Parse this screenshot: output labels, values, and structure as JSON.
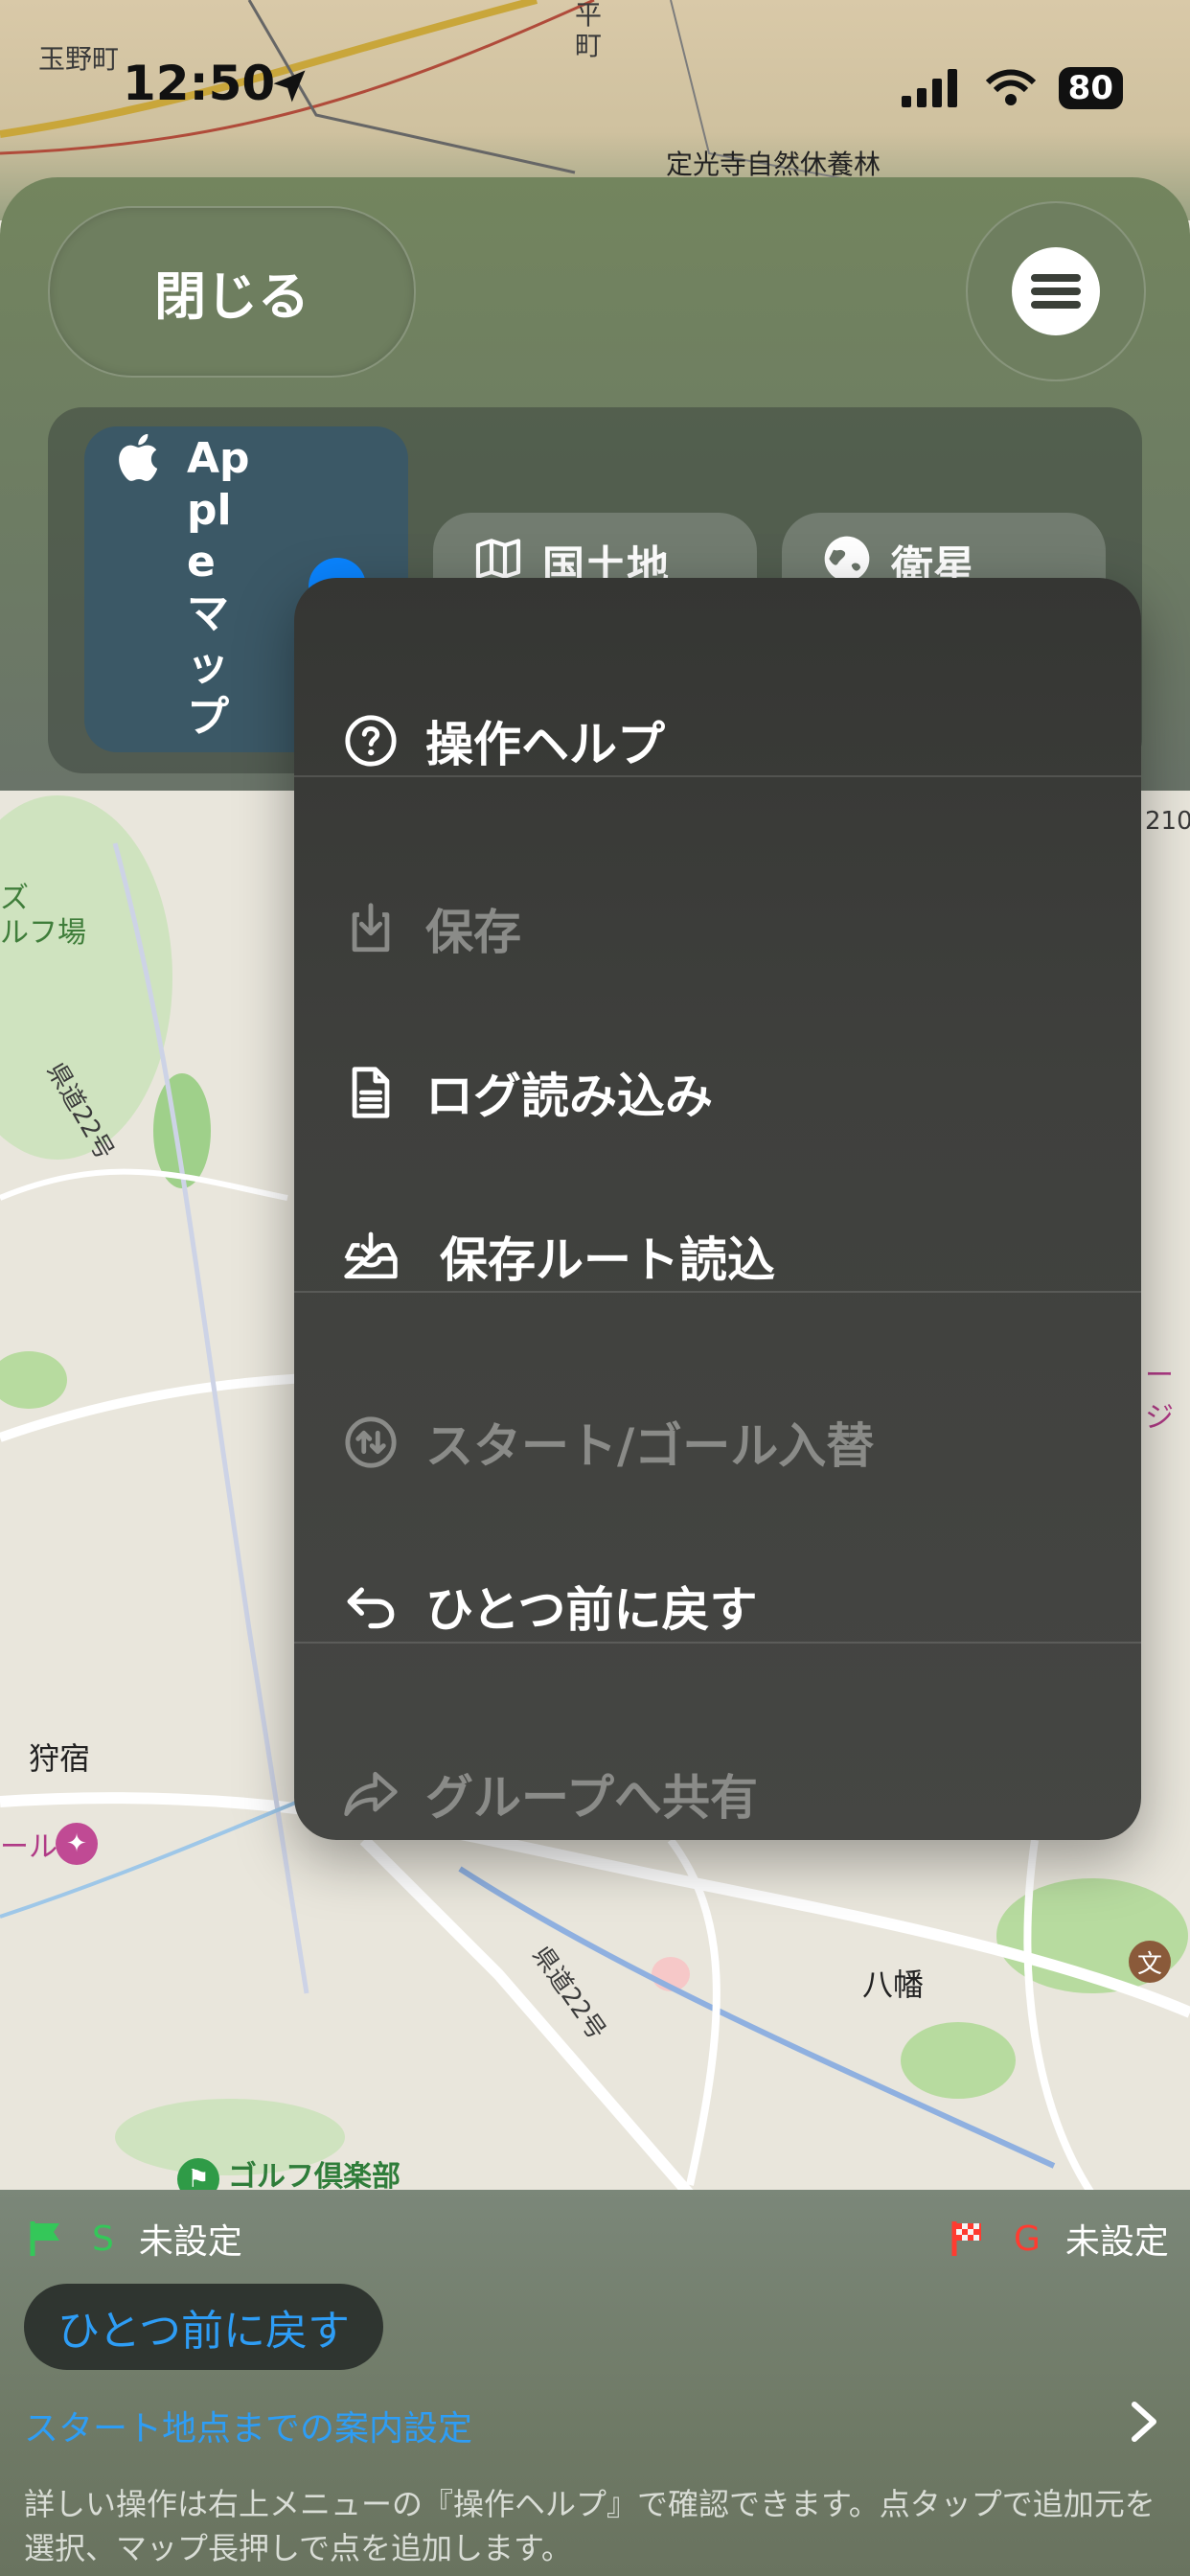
{
  "status_bar": {
    "time": "12:50",
    "battery": "80"
  },
  "map_labels": {
    "top_left": "玉野町",
    "top_mid": "平町",
    "top_right": "定光寺自然休養林",
    "golf": "ズ\nルフ場",
    "road1": "県道22号",
    "kariyado": "狩宿",
    "ball": "ール",
    "road2": "県道22号",
    "yawata": "八幡",
    "golf_club": "ゴルフ倶楽部",
    "route_num": "210",
    "side_text": "ージ"
  },
  "header": {
    "close_label": "閉じる",
    "menu_icon": "list-icon"
  },
  "map_source": {
    "apple_label": "Apple マップ",
    "gsi_label": "国土地",
    "satellite_label": "衛星"
  },
  "menu": {
    "items": [
      {
        "label": "操作ヘルプ",
        "icon": "question-circle-icon",
        "enabled": true
      },
      {
        "label": "保存",
        "icon": "download-tray-icon",
        "enabled": false
      },
      {
        "label": "ログ読み込み",
        "icon": "document-icon",
        "enabled": true
      },
      {
        "label": "保存ルート読込",
        "icon": "inbox-download-icon",
        "enabled": true
      },
      {
        "label": "スタート/ゴール入替",
        "icon": "swap-circle-icon",
        "enabled": false
      },
      {
        "label": "ひとつ前に戻す",
        "icon": "undo-arrow-icon",
        "enabled": true
      },
      {
        "label": "グループへ共有",
        "icon": "share-arrow-icon",
        "enabled": false
      }
    ]
  },
  "bottom": {
    "start_letter": "S",
    "start_value": "未設定",
    "goal_letter": "G",
    "goal_value": "未設定",
    "undo_label": "ひとつ前に戻す",
    "guide_link": "スタート地点までの案内設定",
    "help_text": "詳しい操作は右上メニューの『操作ヘルプ』で確認できます。点タップで追加元を選択、マップ長押しで点を追加します。"
  },
  "colors": {
    "accent_blue": "#2e9df5",
    "start_green": "#34c759",
    "goal_red": "#ff3b30"
  }
}
